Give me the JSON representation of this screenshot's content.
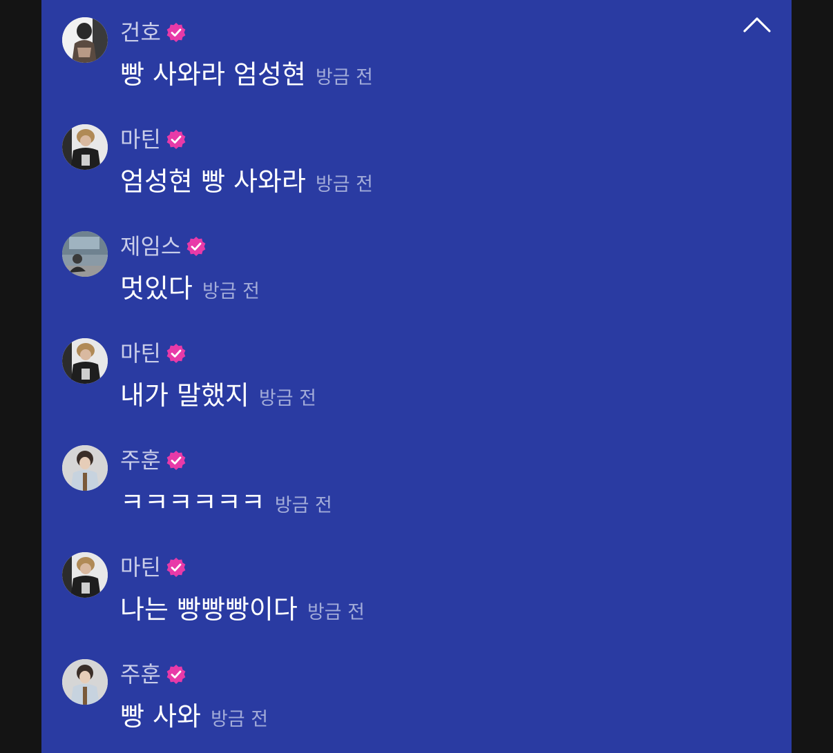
{
  "colors": {
    "panel_background": "#2a3ba2",
    "page_background": "#141414",
    "username_text": "#c9cde9",
    "message_text": "#ffffff",
    "timestamp_text": "#a3acd9",
    "verified_badge": "#e83aa8"
  },
  "header": {
    "collapse_icon": "chevron-up-icon"
  },
  "comments": [
    {
      "user": "건호",
      "verified": true,
      "text": "빵 사와라 엄성현",
      "time": "방금 전"
    },
    {
      "user": "마틴",
      "verified": true,
      "text": "엄성현 빵 사와라",
      "time": "방금 전"
    },
    {
      "user": "제임스",
      "verified": true,
      "text": "멋있다",
      "time": "방금 전"
    },
    {
      "user": "마틴",
      "verified": true,
      "text": "내가 말했지",
      "time": "방금 전"
    },
    {
      "user": "주훈",
      "verified": true,
      "text": "ㅋㅋㅋㅋㅋㅋ",
      "time": "방금 전"
    },
    {
      "user": "마틴",
      "verified": true,
      "text": "나는 빵빵빵이다",
      "time": "방금 전"
    },
    {
      "user": "주훈",
      "verified": true,
      "text": "빵 사와",
      "time": "방금 전"
    }
  ]
}
